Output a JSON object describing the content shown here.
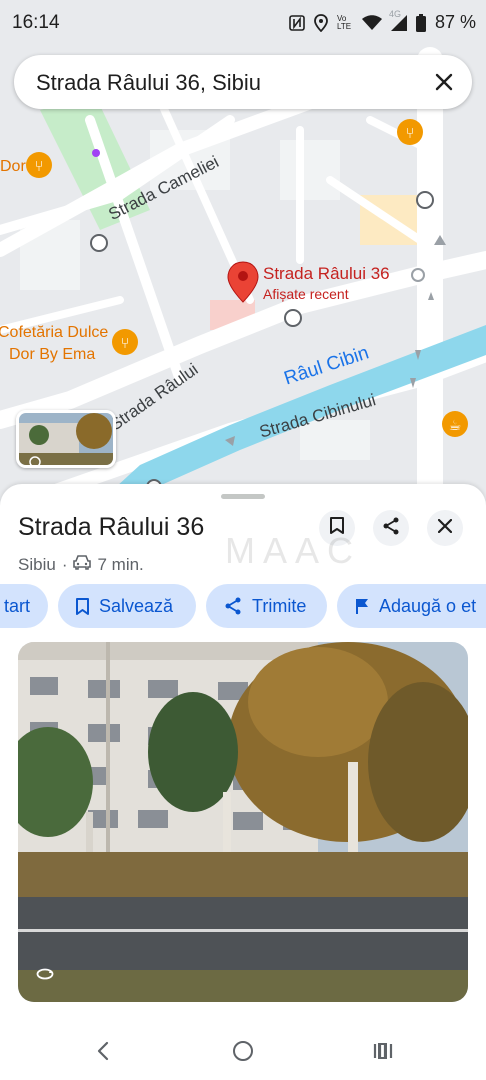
{
  "status_bar": {
    "time": "16:14",
    "battery": "87 %",
    "network": "4G",
    "volte": "Vo LTE",
    "icons": [
      "nfc-icon",
      "location-icon",
      "wifi-icon",
      "signal-icon",
      "battery-icon"
    ]
  },
  "search": {
    "query": "Strada Râului 36, Sibiu"
  },
  "map": {
    "streets": [
      "Strada Cameliei",
      "Strada Râului",
      "Strada Cibinului"
    ],
    "river": "Râul Cibin",
    "pois": [
      "Dor",
      "Cofetăria Dulce",
      "Dor By Ema"
    ],
    "pin": {
      "title": "Strada Râului 36",
      "subtitle": "Afișate recent"
    },
    "colors": {
      "river": "#8ed7ec",
      "pin": "#ea4335",
      "poi": "#f29900",
      "park": "#c6ecc9"
    }
  },
  "place": {
    "title": "Strada Râului 36",
    "city": "Sibiu",
    "separator": "·",
    "drive_time": "7 min."
  },
  "actions": {
    "start": "tart",
    "save": "Salvează",
    "share": "Trimite",
    "add_label": "Adaugă o et"
  },
  "watermark": "MAAC"
}
